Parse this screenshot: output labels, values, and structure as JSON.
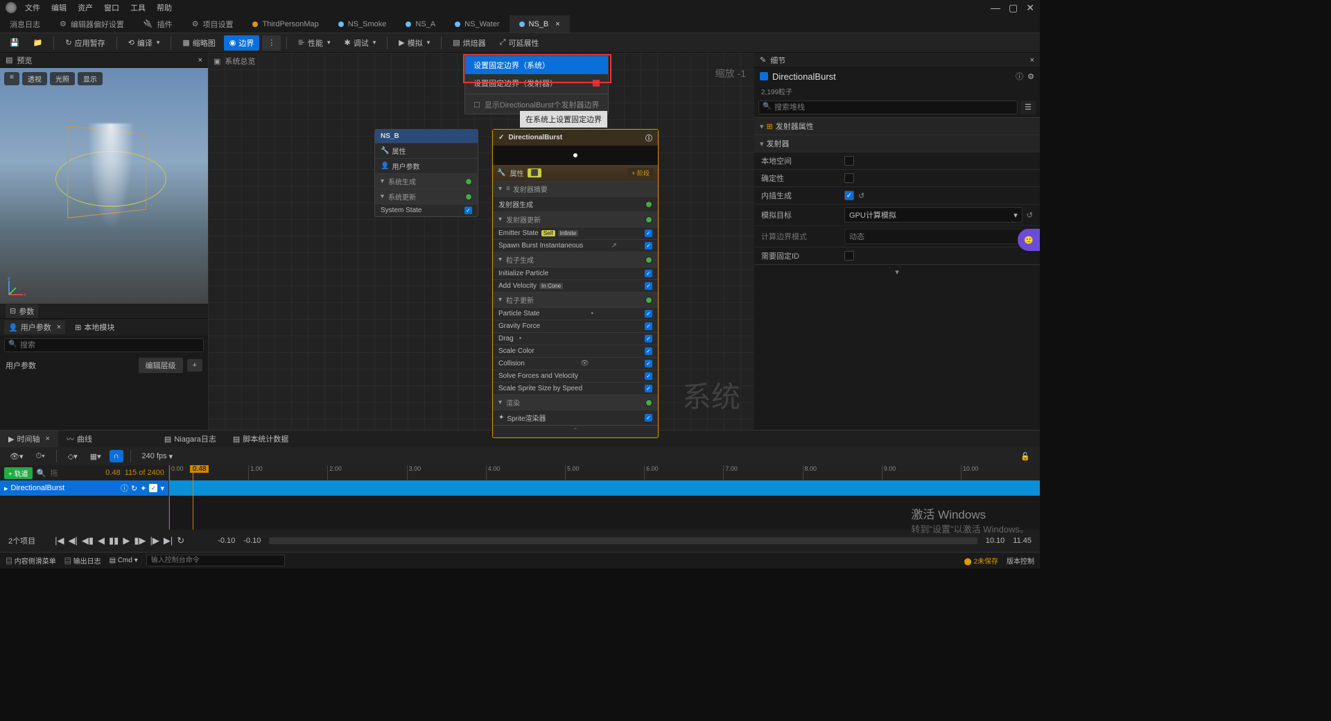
{
  "menu": {
    "items": [
      "文件",
      "编辑",
      "资产",
      "窗口",
      "工具",
      "帮助"
    ]
  },
  "window_buttons": {
    "min": "—",
    "max": "▢",
    "close": "✕"
  },
  "tabs": [
    {
      "icon_color": "#888",
      "label": "消息日志"
    },
    {
      "icon_color": "#888",
      "label": "编辑器偏好设置",
      "prefix_icon": "sliders"
    },
    {
      "icon_color": "#888",
      "label": "插件",
      "prefix_icon": "plug"
    },
    {
      "icon_color": "#888",
      "label": "项目设置",
      "prefix_icon": "gear"
    },
    {
      "icon_color": "#d90",
      "label": "ThirdPersonMap"
    },
    {
      "icon_color": "#6bf",
      "label": "NS_Smoke"
    },
    {
      "icon_color": "#6bf",
      "label": "NS_A"
    },
    {
      "icon_color": "#6bf",
      "label": "NS_Water"
    },
    {
      "icon_color": "#6bf",
      "label": "NS_B",
      "active": true,
      "close": "×"
    }
  ],
  "toolbar": {
    "save": "保存",
    "browse": "浏览",
    "apply_scratch": "应用暂存",
    "compile": "编译",
    "thumbnail": "缩略图",
    "bounds": "边界",
    "performance": "性能",
    "debug": "调试",
    "simulate": "模拟",
    "baker": "烘焙器",
    "scalability": "可延展性"
  },
  "graph": {
    "overview_label": "系统总览",
    "title": "NS_B",
    "zoom": "缩放 -1",
    "watermark": "系统"
  },
  "context_menu": {
    "item1": "设置固定边界（系统）",
    "item2": "设置固定边界（发射器）",
    "item3": "显示DirectionalBurst个发射器边界",
    "tooltip": "在系统上设置固定边界"
  },
  "preview": {
    "panel_label": "预览",
    "btn_perspective": "透视",
    "btn_lit": "光照",
    "btn_show": "显示"
  },
  "params": {
    "panel_label": "参数",
    "tab_user": "用户参数",
    "tab_local": "本地模块",
    "search_placeholder": "搜索",
    "user_params_label": "用户参数",
    "edit_hierarchy": "编辑层级",
    "add": "+"
  },
  "system_node": {
    "title": "NS_B",
    "row_properties": "属性",
    "row_user_params": "用户参数",
    "row_sys_spawn": "系统生成",
    "row_sys_update": "系统更新",
    "row_system_state": "System State"
  },
  "emitter_node": {
    "title": "DirectionalBurst",
    "properties_label": "属性",
    "stage": "+ 阶段",
    "sec_summary": "发射器摘要",
    "row_emitter_spawn": "发射器生成",
    "sec_emitter_update": "发射器更新",
    "row_emitter_state": "Emitter State",
    "tag_self": "Self",
    "tag_infinite": "Infinite",
    "row_spawn_burst": "Spawn Burst Instantaneous",
    "sec_particle_spawn": "粒子生成",
    "row_init_particle": "Initialize Particle",
    "row_add_velocity": "Add Velocity",
    "tag_in_cone": "In Cone",
    "sec_particle_update": "粒子更新",
    "row_particle_state": "Particle State",
    "row_gravity": "Gravity Force",
    "row_drag": "Drag",
    "row_scale_color": "Scale Color",
    "row_collision": "Collision",
    "row_solve_forces": "Solve Forces and Velocity",
    "row_scale_sprite": "Scale Sprite Size by Speed",
    "sec_render": "渲染",
    "row_sprite_renderer": "Sprite渲染器",
    "expand": "ˆ"
  },
  "details": {
    "panel_label": "细节",
    "title": "DirectionalBurst",
    "particle_count": "2,199粒子",
    "search_placeholder": "搜索堆栈",
    "sec_emitter_props": "发射器属性",
    "sec_emitter": "发射器",
    "row_local_space": "本地空间",
    "row_determinism": "确定性",
    "row_interpolate": "内插生成",
    "row_sim_target": "模拟目标",
    "val_sim_target": "GPU计算模拟",
    "row_bounds_mode": "计算边界模式",
    "val_bounds_mode": "动态",
    "row_fixed_id": "需要固定ID"
  },
  "timeline": {
    "tab_timeline": "时间轴",
    "tab_curves": "曲线",
    "tab_niagara_log": "Niagara日志",
    "tab_script_stats": "脚本统计数据",
    "fps": "240 fps",
    "add_track": "+ 轨道",
    "cur_frame": "0.48",
    "frame_info": "115 of 2400",
    "playhead": "0.48",
    "ticks": [
      "0.00",
      "1.00",
      "2.00",
      "3.00",
      "4.00",
      "5.00",
      "6.00",
      "7.00",
      "8.00",
      "9.00",
      "10.00"
    ],
    "track_name": "DirectionalBurst",
    "items_count": "2个项目",
    "range_start": "-0.10",
    "range_start2": "-0.10",
    "range_end": "10.10",
    "range_end2": "11.45"
  },
  "bottombar": {
    "drawer": "内容侧滑菜单",
    "output_log": "输出日志",
    "cmd_label": "Cmd",
    "cmd_placeholder": "输入控制台命令",
    "unsaved": "2未保存",
    "revision": "版本控制"
  },
  "watermark": {
    "line1": "激活 Windows",
    "line2": "转到\"设置\"以激活 Windows。"
  }
}
